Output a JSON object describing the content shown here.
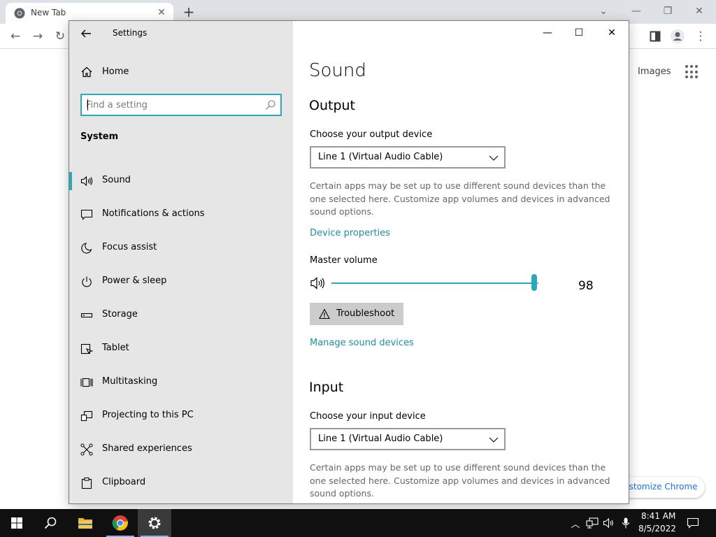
{
  "browser": {
    "tab_title": "New Tab",
    "link_images": "Images",
    "customize_label": "ustomize Chrome",
    "colors": {
      "tabstrip": "#dee1e6",
      "link_blue": "#1a73e8"
    }
  },
  "settings": {
    "window_title": "Settings",
    "home_label": "Home",
    "search_placeholder": "Find a setting",
    "category": "System",
    "nav_items": [
      {
        "label": "Sound",
        "icon": "speaker-icon",
        "active": true
      },
      {
        "label": "Notifications & actions",
        "icon": "notification-icon",
        "active": false
      },
      {
        "label": "Focus assist",
        "icon": "moon-icon",
        "active": false
      },
      {
        "label": "Power & sleep",
        "icon": "power-icon",
        "active": false
      },
      {
        "label": "Storage",
        "icon": "storage-icon",
        "active": false
      },
      {
        "label": "Tablet",
        "icon": "tablet-icon",
        "active": false
      },
      {
        "label": "Multitasking",
        "icon": "multitasking-icon",
        "active": false
      },
      {
        "label": "Projecting to this PC",
        "icon": "projecting-icon",
        "active": false
      },
      {
        "label": "Shared experiences",
        "icon": "shared-experiences-icon",
        "active": false
      },
      {
        "label": "Clipboard",
        "icon": "clipboard-icon",
        "active": false
      }
    ],
    "accent_color": "#2aa9b8",
    "link_color": "#1b8fa0"
  },
  "sound": {
    "page_title": "Sound",
    "output": {
      "section_title": "Output",
      "device_label": "Choose your output device",
      "device_value": "Line 1 (Virtual Audio Cable)",
      "description": "Certain apps may be set up to use different sound devices than the one selected here. Customize app volumes and devices in advanced sound options.",
      "device_properties_link": "Device properties",
      "master_volume_label": "Master volume",
      "master_volume": 98,
      "troubleshoot_label": "Troubleshoot",
      "manage_devices_link": "Manage sound devices"
    },
    "input": {
      "section_title": "Input",
      "device_label": "Choose your input device",
      "device_value": "Line 1 (Virtual Audio Cable)",
      "description": "Certain apps may be set up to use different sound devices than the one selected here. Customize app volumes and devices in advanced sound options."
    }
  },
  "taskbar": {
    "time": "8:41 AM",
    "date": "8/5/2022"
  }
}
